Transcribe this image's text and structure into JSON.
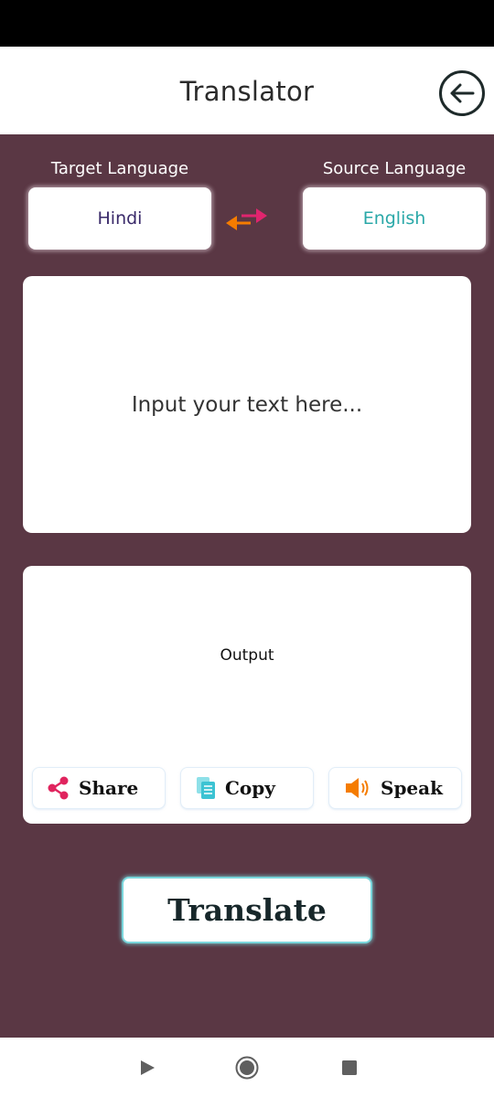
{
  "app_bar": {
    "title": "Translator",
    "back_icon": "arrow-left-circle-icon"
  },
  "languages": {
    "target_label": "Target Language",
    "target_value": "Hindi",
    "source_label": "Source Language",
    "source_value": "English",
    "swap_icon": "swap-arrows-icon"
  },
  "input": {
    "placeholder": "Input your text here..."
  },
  "output": {
    "label": "Output",
    "actions": [
      {
        "label": "Share",
        "icon": "share-icon"
      },
      {
        "label": "Copy",
        "icon": "copy-icon"
      },
      {
        "label": "Speak",
        "icon": "speaker-icon"
      }
    ]
  },
  "translate_button": {
    "label": "Translate"
  },
  "nav": {
    "back_icon": "nav-back-icon",
    "home_icon": "nav-home-icon",
    "recents_icon": "nav-recents-icon"
  },
  "colors": {
    "background": "#5a3744",
    "target_text": "#3a2a6a",
    "source_text": "#2aa8a8",
    "share": "#e0245e",
    "copy": "#3cc3d3",
    "speak": "#f57c00",
    "translate_border": "#7ad6dc"
  }
}
